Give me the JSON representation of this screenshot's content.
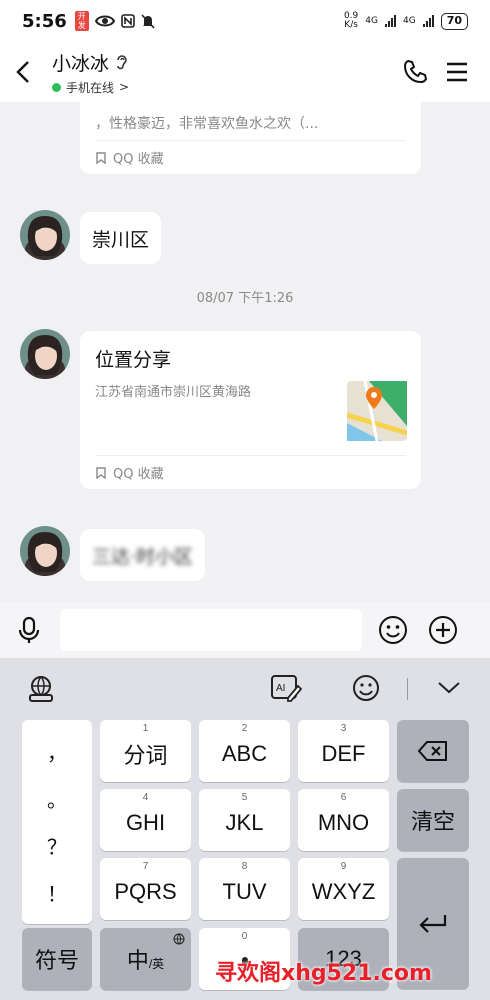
{
  "status_bar": {
    "time": "5:56",
    "badge": "开发",
    "net_speed_value": "0.9",
    "net_speed_unit": "K/s",
    "net1": "4G",
    "net2": "4G",
    "battery": "70"
  },
  "header": {
    "contact_name": "小冰冰",
    "online_status": "手机在线",
    "online_chevron": ">"
  },
  "chat": {
    "card1": {
      "text": "，性格豪迈，非常喜欢鱼水之欢（...",
      "collect_label": "QQ 收藏"
    },
    "message1": "崇川区",
    "timestamp": "08/07 下午1:26",
    "location_card": {
      "title": "位置分享",
      "address": "江苏省南通市崇川区黄海路",
      "collect_label": "QQ 收藏"
    },
    "message2": "三达·时小区"
  },
  "input_bar": {
    "placeholder": ""
  },
  "keyboard": {
    "punct_keys": [
      "，",
      "。",
      "？",
      "！"
    ],
    "row1": [
      {
        "num": "1",
        "label": "分词"
      },
      {
        "num": "2",
        "label": "ABC"
      },
      {
        "num": "3",
        "label": "DEF"
      }
    ],
    "row2": [
      {
        "num": "4",
        "label": "GHI"
      },
      {
        "num": "5",
        "label": "JKL"
      },
      {
        "num": "6",
        "label": "MNO"
      }
    ],
    "row3": [
      {
        "num": "7",
        "label": "PQRS"
      },
      {
        "num": "8",
        "label": "TUV"
      },
      {
        "num": "9",
        "label": "WXYZ"
      }
    ],
    "clear_label": "清空",
    "symbol_label": "符号",
    "lang_label": "中",
    "lang_sub": "/英",
    "space_num": "0",
    "num_label": "123"
  },
  "watermark": "寻欢阁xhg521.com",
  "colors": {
    "online_dot": "#2ebd59",
    "map_pin": "#f07a1a",
    "watermark": "#e8202a"
  }
}
